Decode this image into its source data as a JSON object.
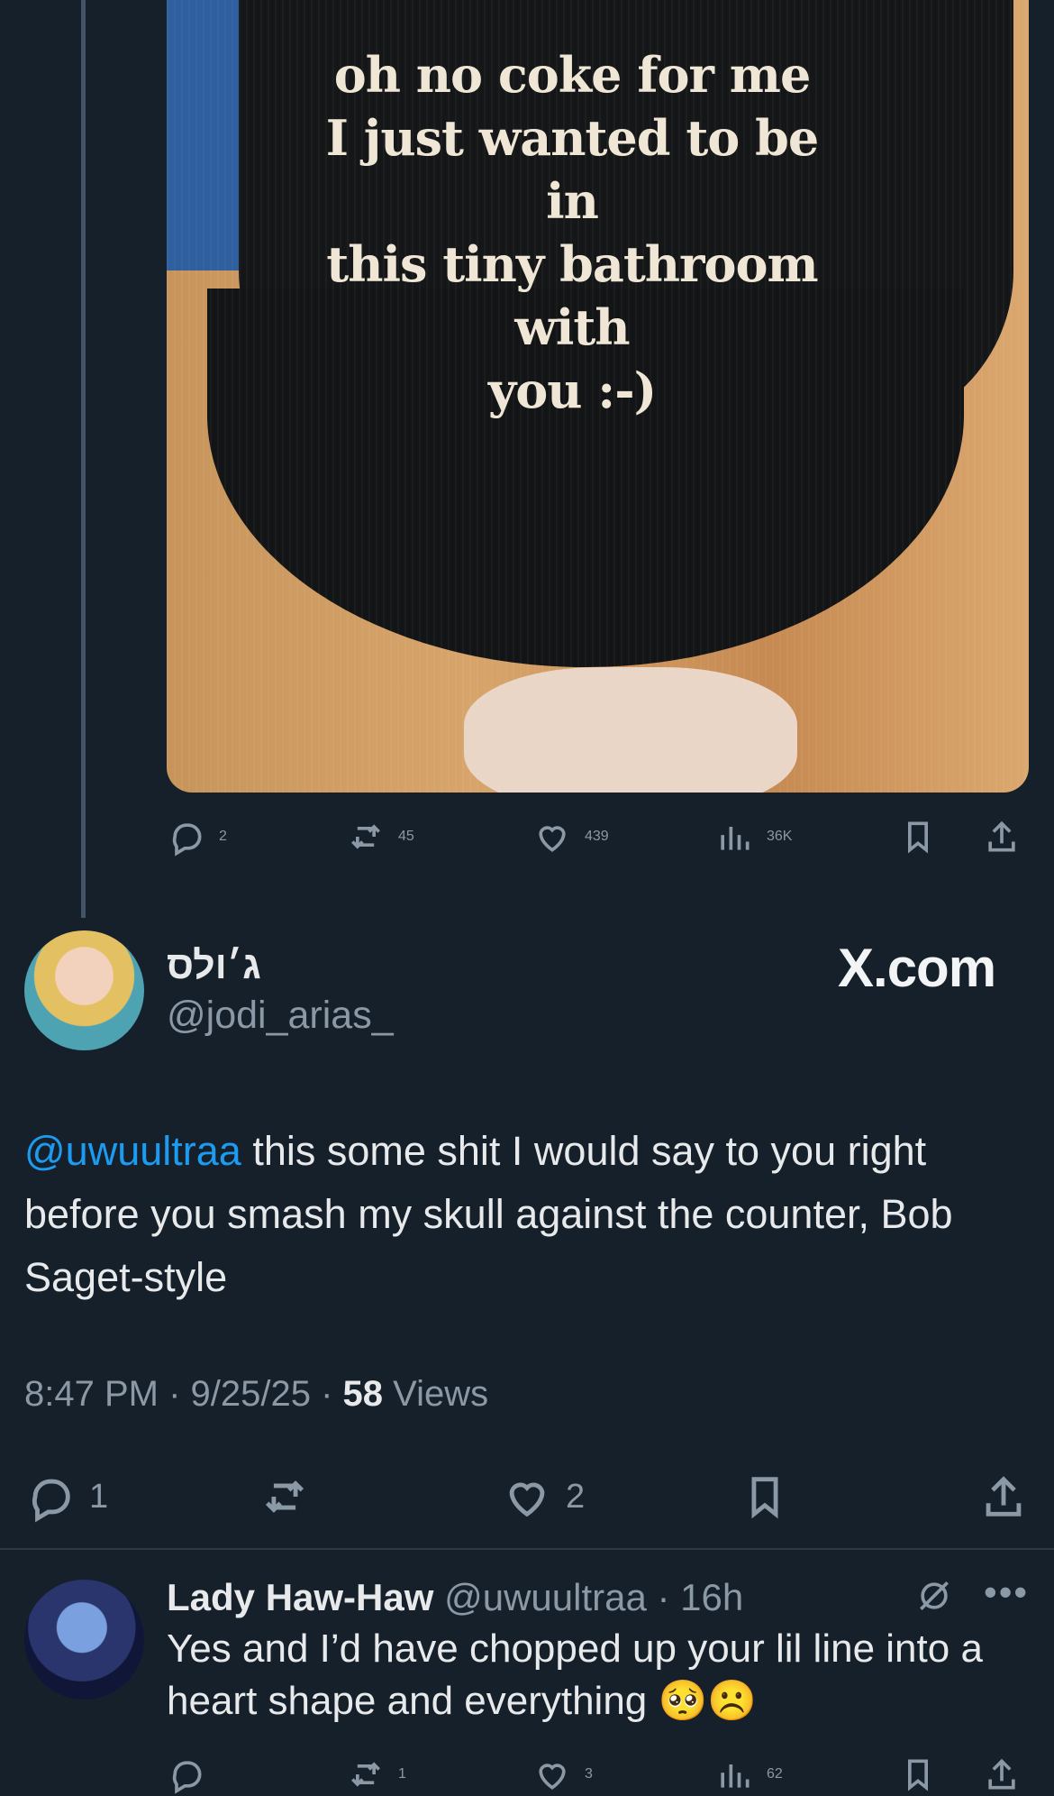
{
  "top_tweet": {
    "image": {
      "alt": "black corduroy cap",
      "cap_text": "oh no coke for me\nI just wanted to be in\nthis tiny bathroom with\nyou :-)"
    },
    "actions": {
      "reply_count": "2",
      "repost_count": "45",
      "like_count": "439",
      "view_count": "36K"
    }
  },
  "main_tweet": {
    "display_name": "ג׳ולס",
    "handle": "@jodi_arias_",
    "watermark": "X.com",
    "mention": "@uwuultraa",
    "text": " this some shit I would say to you right before you smash my skull against the counter, Bob Saget-style",
    "time": "8:47 PM · 9/25/25 · ",
    "views_count": "58",
    "views_label": " Views",
    "actions": {
      "reply_count": "1",
      "like_count": "2"
    }
  },
  "reply_tweet": {
    "display_name": "Lady Haw-Haw",
    "handle": "@uwuultraa",
    "time": " · 16h",
    "text": "Yes and I’d have chopped up your lil line into a heart shape and everything 🥺☹️",
    "actions": {
      "repost_count": "1",
      "like_count": "3",
      "view_count": "62"
    }
  },
  "colors": {
    "background": "#15202b",
    "text": "#e7e9ea",
    "muted": "#8b98a5",
    "accent": "#1d9bf0"
  }
}
